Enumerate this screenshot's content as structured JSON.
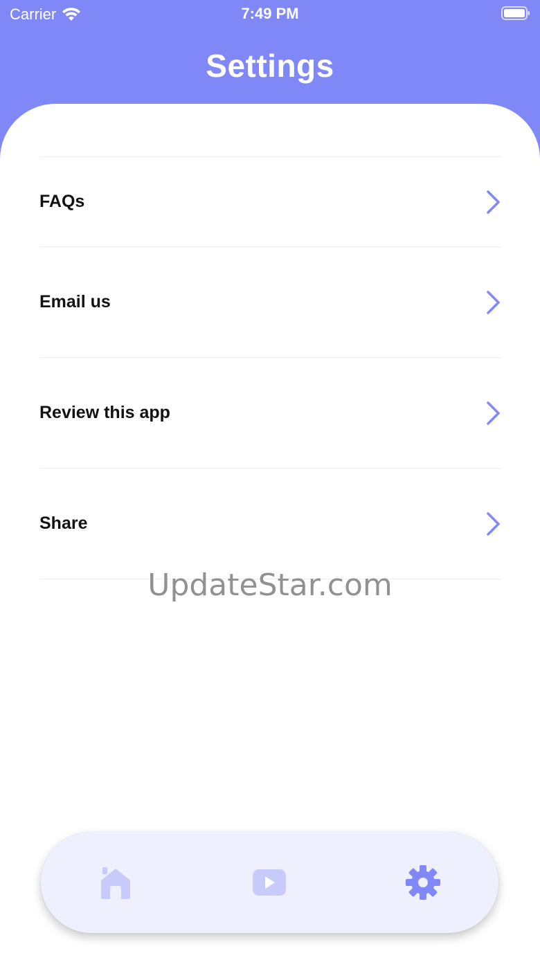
{
  "status_bar": {
    "carrier": "Carrier",
    "time": "7:49 PM",
    "icons": [
      "wifi-icon",
      "battery-icon"
    ]
  },
  "header": {
    "title": "Settings"
  },
  "settings": {
    "items": [
      {
        "label": "FAQs",
        "icon": "chevron-right-icon"
      },
      {
        "label": "Email us",
        "icon": "chevron-right-icon"
      },
      {
        "label": "Review this app",
        "icon": "chevron-right-icon"
      },
      {
        "label": "Share",
        "icon": "chevron-right-icon"
      }
    ]
  },
  "watermark": "UpdateStar.com",
  "tab_bar": {
    "tabs": [
      {
        "name": "home",
        "icon": "home-icon",
        "active": false
      },
      {
        "name": "video",
        "icon": "play-icon",
        "active": false
      },
      {
        "name": "settings",
        "icon": "gear-icon",
        "active": true
      }
    ]
  },
  "colors": {
    "accent": "#8088F8",
    "accent_inactive": "#C7CBFA",
    "tab_bar_bg": "#EEF0FE",
    "text": "#111111"
  }
}
